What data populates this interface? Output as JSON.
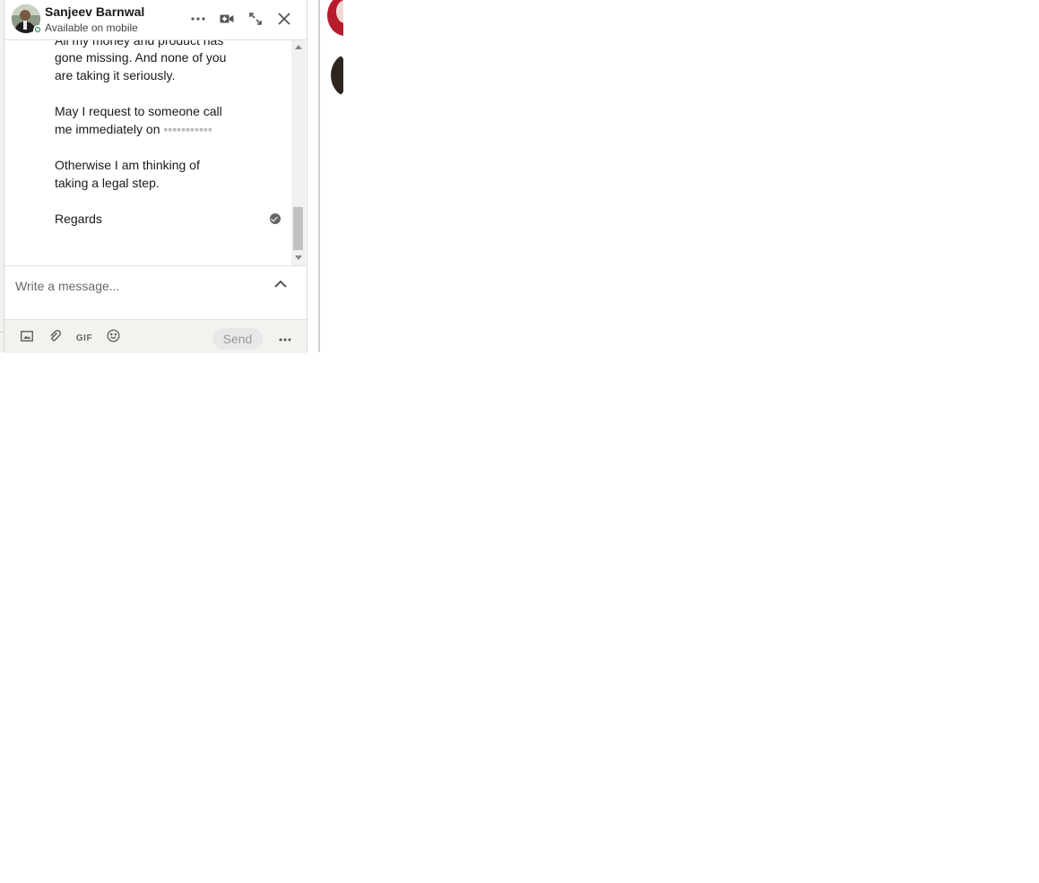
{
  "chat": {
    "contact_name": "Sanjeev Barnwal",
    "status_text": "Available on mobile",
    "header_icons": [
      "more-options-icon",
      "video-call-icon",
      "expand-icon",
      "close-icon"
    ],
    "messages": [
      "All my money and product has",
      "gone missing. And none of you",
      "are taking it seriously.",
      "May I request to someone call",
      "me immediately on",
      "Otherwise I am thinking of",
      "taking a legal step.",
      "Regards"
    ],
    "compose_placeholder": "Write a message...",
    "send_label": "Send",
    "footer_icons": [
      "image-icon",
      "attachment-icon",
      "gif-icon",
      "emoji-icon",
      "more-options-icon"
    ],
    "gif_label": "GIF"
  },
  "colors": {
    "presence_green": "#057642",
    "send_disabled_bg": "#e8e8e8",
    "footer_bg": "#f3f2ef"
  }
}
